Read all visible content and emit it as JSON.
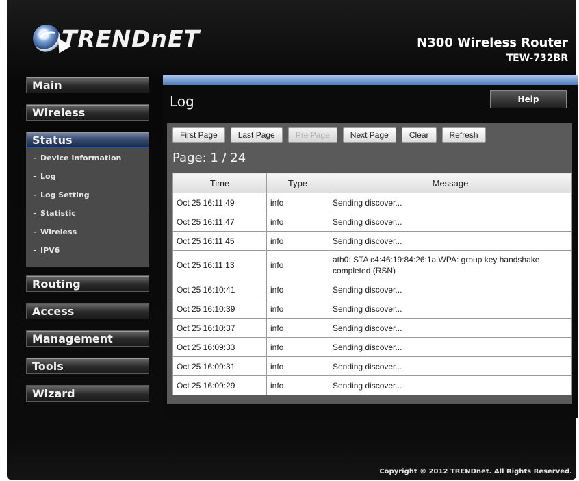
{
  "header": {
    "logo_text": "TRENDnET",
    "product_name": "N300 Wireless Router",
    "model": "TEW-732BR"
  },
  "sidebar": {
    "items": [
      {
        "label": "Main"
      },
      {
        "label": "Wireless"
      },
      {
        "label": "Status"
      },
      {
        "label": "Routing"
      },
      {
        "label": "Access"
      },
      {
        "label": "Management"
      },
      {
        "label": "Tools"
      },
      {
        "label": "Wizard"
      }
    ],
    "status_subitems": [
      {
        "label": "Device Information"
      },
      {
        "label": "Log"
      },
      {
        "label": "Log Setting"
      },
      {
        "label": "Statistic"
      },
      {
        "label": "Wireless"
      },
      {
        "label": "IPV6"
      }
    ]
  },
  "main": {
    "title": "Log",
    "help_label": "Help",
    "toolbar": {
      "first_page": "First Page",
      "last_page": "Last Page",
      "pre_page": "Pre Page",
      "next_page": "Next Page",
      "clear": "Clear",
      "refresh": "Refresh"
    },
    "page_indicator": "Page: 1 / 24",
    "table": {
      "headers": [
        "Time",
        "Type",
        "Message"
      ],
      "rows": [
        {
          "time": "Oct 25 16:11:49",
          "type": "info",
          "message": "Sending discover..."
        },
        {
          "time": "Oct 25 16:11:47",
          "type": "info",
          "message": "Sending discover..."
        },
        {
          "time": "Oct 25 16:11:45",
          "type": "info",
          "message": "Sending discover..."
        },
        {
          "time": "Oct 25 16:11:13",
          "type": "info",
          "message": "ath0: STA c4:46:19:84:26:1a WPA: group key handshake completed (RSN)"
        },
        {
          "time": "Oct 25 16:10:41",
          "type": "info",
          "message": "Sending discover..."
        },
        {
          "time": "Oct 25 16:10:39",
          "type": "info",
          "message": "Sending discover..."
        },
        {
          "time": "Oct 25 16:10:37",
          "type": "info",
          "message": "Sending discover..."
        },
        {
          "time": "Oct 25 16:09:33",
          "type": "info",
          "message": "Sending discover..."
        },
        {
          "time": "Oct 25 16:09:31",
          "type": "info",
          "message": "Sending discover..."
        },
        {
          "time": "Oct 25 16:09:29",
          "type": "info",
          "message": "Sending discover..."
        }
      ]
    }
  },
  "footer": {
    "copyright": "Copyright © 2012 TRENDnet. All Rights Reserved."
  }
}
